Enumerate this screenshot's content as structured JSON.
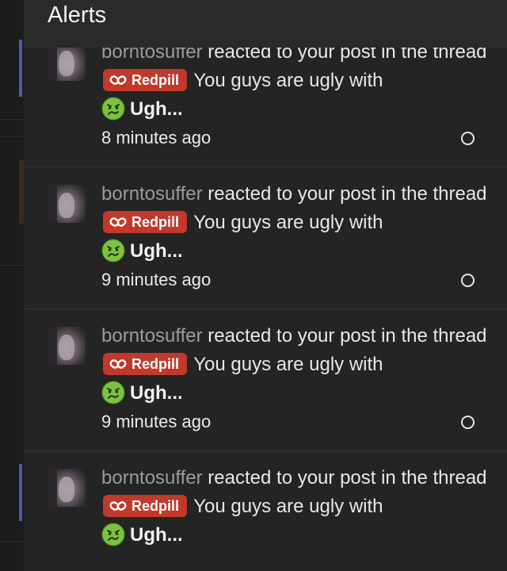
{
  "header": {
    "title": "Alerts"
  },
  "alerts": [
    {
      "username": "borntosuffer",
      "action_text": " reacted to your post in the thread ",
      "prefix": "Redpill",
      "thread_title": " You guys are ugly with",
      "reaction": "Ugh...",
      "time": "8 minutes ago"
    },
    {
      "username": "borntosuffer",
      "action_text": " reacted to your post in the thread ",
      "prefix": "Redpill",
      "thread_title": " You guys are ugly with",
      "reaction": "Ugh...",
      "time": "9 minutes ago"
    },
    {
      "username": "borntosuffer",
      "action_text": " reacted to your post in the thread ",
      "prefix": "Redpill",
      "thread_title": " You guys are ugly with",
      "reaction": "Ugh...",
      "time": "9 minutes ago"
    },
    {
      "username": "borntosuffer",
      "action_text": " reacted to your post in the thread ",
      "prefix": "Redpill",
      "thread_title": " You guys are ugly with",
      "reaction": "Ugh...",
      "time": ""
    }
  ],
  "colors": {
    "prefix_badge": "#c0392b",
    "reaction_face": "#7cc242",
    "background_accent": "#4a5bb0"
  },
  "icons": {
    "prefix": "pill-icon",
    "reaction": "sick-face-icon",
    "read_toggle": "circle-icon"
  }
}
